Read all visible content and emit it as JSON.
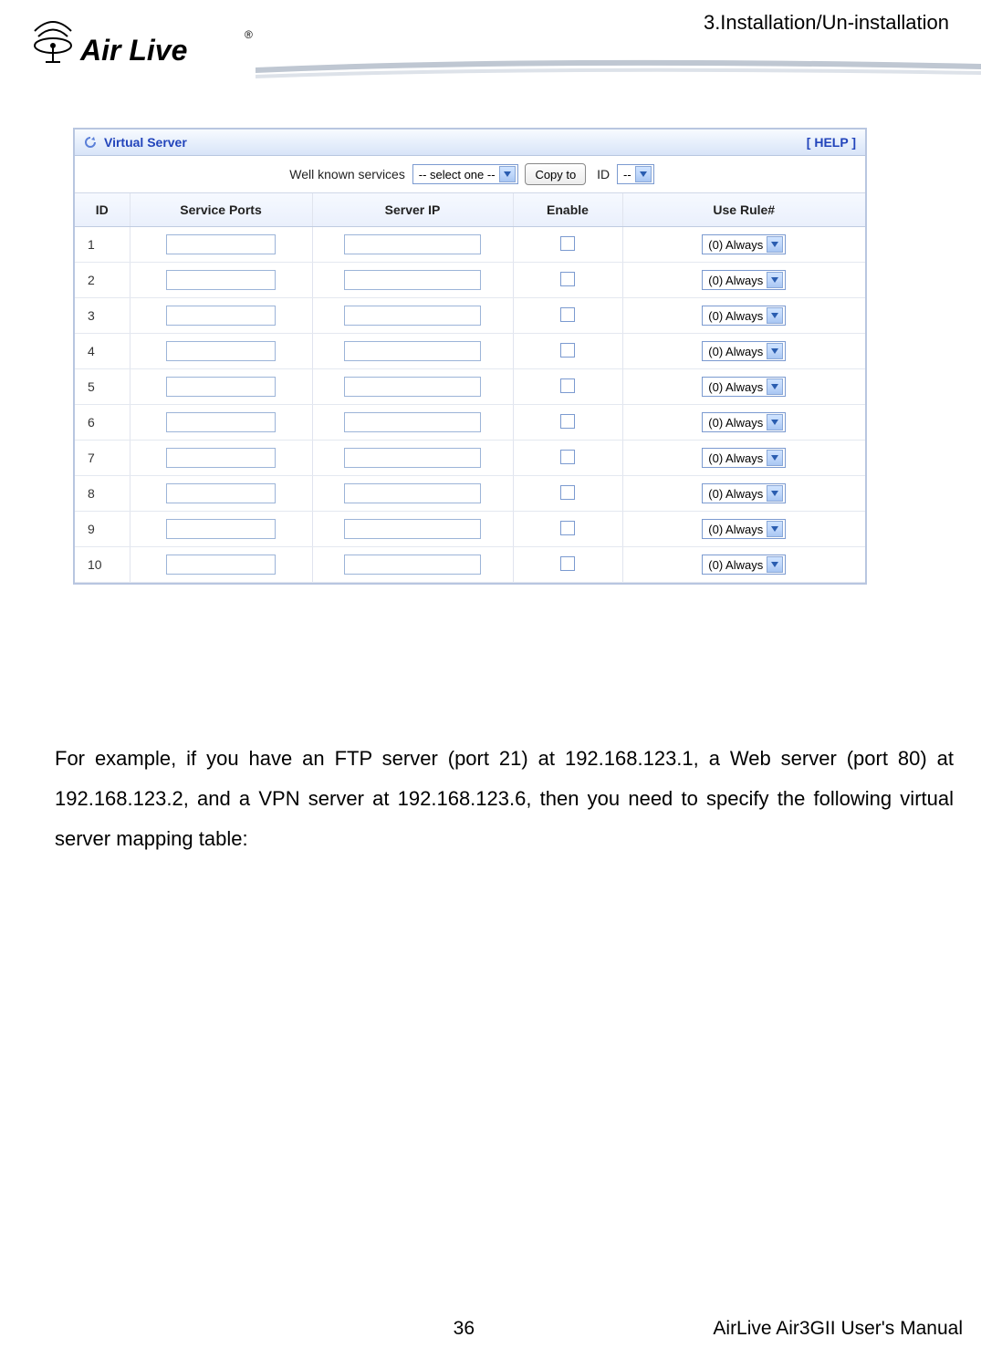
{
  "page": {
    "header_section": "3.Installation/Un-installation",
    "brand": "Air Live",
    "brand_reg": "®"
  },
  "panel": {
    "title": "Virtual Server",
    "help": "[ HELP ]",
    "toolbar": {
      "well_known_label": "Well known services",
      "well_known_value": "-- select one --",
      "copy_to": "Copy to",
      "id_label": "ID",
      "id_value": "--"
    },
    "columns": {
      "id": "ID",
      "service_ports": "Service Ports",
      "server_ip": "Server IP",
      "enable": "Enable",
      "use_rule": "Use Rule#"
    },
    "rows": [
      {
        "id": "1",
        "ports": "",
        "ip": "",
        "enable": false,
        "rule": "(0) Always"
      },
      {
        "id": "2",
        "ports": "",
        "ip": "",
        "enable": false,
        "rule": "(0) Always"
      },
      {
        "id": "3",
        "ports": "",
        "ip": "",
        "enable": false,
        "rule": "(0) Always"
      },
      {
        "id": "4",
        "ports": "",
        "ip": "",
        "enable": false,
        "rule": "(0) Always"
      },
      {
        "id": "5",
        "ports": "",
        "ip": "",
        "enable": false,
        "rule": "(0) Always"
      },
      {
        "id": "6",
        "ports": "",
        "ip": "",
        "enable": false,
        "rule": "(0) Always"
      },
      {
        "id": "7",
        "ports": "",
        "ip": "",
        "enable": false,
        "rule": "(0) Always"
      },
      {
        "id": "8",
        "ports": "",
        "ip": "",
        "enable": false,
        "rule": "(0) Always"
      },
      {
        "id": "9",
        "ports": "",
        "ip": "",
        "enable": false,
        "rule": "(0) Always"
      },
      {
        "id": "10",
        "ports": "",
        "ip": "",
        "enable": false,
        "rule": "(0) Always"
      }
    ]
  },
  "body": {
    "paragraph": "For example, if you have an FTP server (port 21) at 192.168.123.1, a Web server (port 80) at 192.168.123.2, and a VPN server at 192.168.123.6, then you need to specify the following virtual server mapping table:"
  },
  "footer": {
    "page_number": "36",
    "manual_title": "AirLive Air3GII User's Manual"
  }
}
